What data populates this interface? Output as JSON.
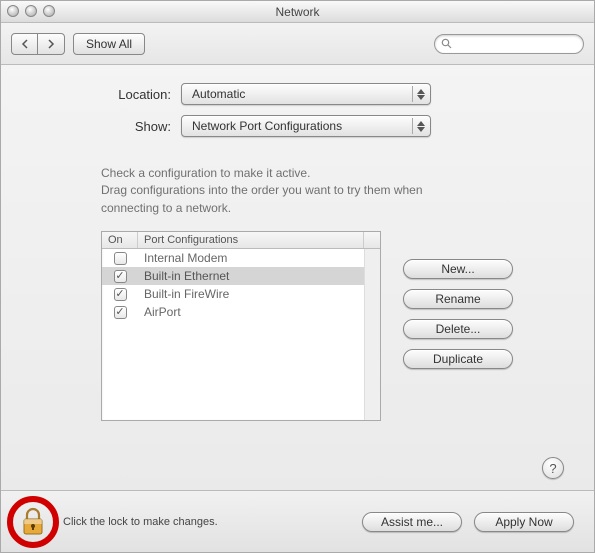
{
  "window": {
    "title": "Network"
  },
  "toolbar": {
    "show_all_label": "Show All",
    "search_placeholder": ""
  },
  "location": {
    "label": "Location:",
    "value": "Automatic"
  },
  "show": {
    "label": "Show:",
    "value": "Network Port Configurations"
  },
  "helptext": {
    "line1": "Check a configuration to make it active.",
    "line2": "Drag configurations into the order you want to try them when connecting to a network."
  },
  "list": {
    "col_on": "On",
    "col_name": "Port Configurations",
    "rows": [
      {
        "checked": false,
        "name": "Internal Modem",
        "selected": false
      },
      {
        "checked": true,
        "name": "Built-in Ethernet",
        "selected": true
      },
      {
        "checked": true,
        "name": "Built-in FireWire",
        "selected": false
      },
      {
        "checked": true,
        "name": "AirPort",
        "selected": false
      }
    ]
  },
  "buttons": {
    "new": "New...",
    "rename": "Rename",
    "delete": "Delete...",
    "duplicate": "Duplicate"
  },
  "help": {
    "glyph": "?"
  },
  "footer": {
    "lock_text": "Click the lock to make changes.",
    "assist": "Assist me...",
    "apply": "Apply Now"
  }
}
